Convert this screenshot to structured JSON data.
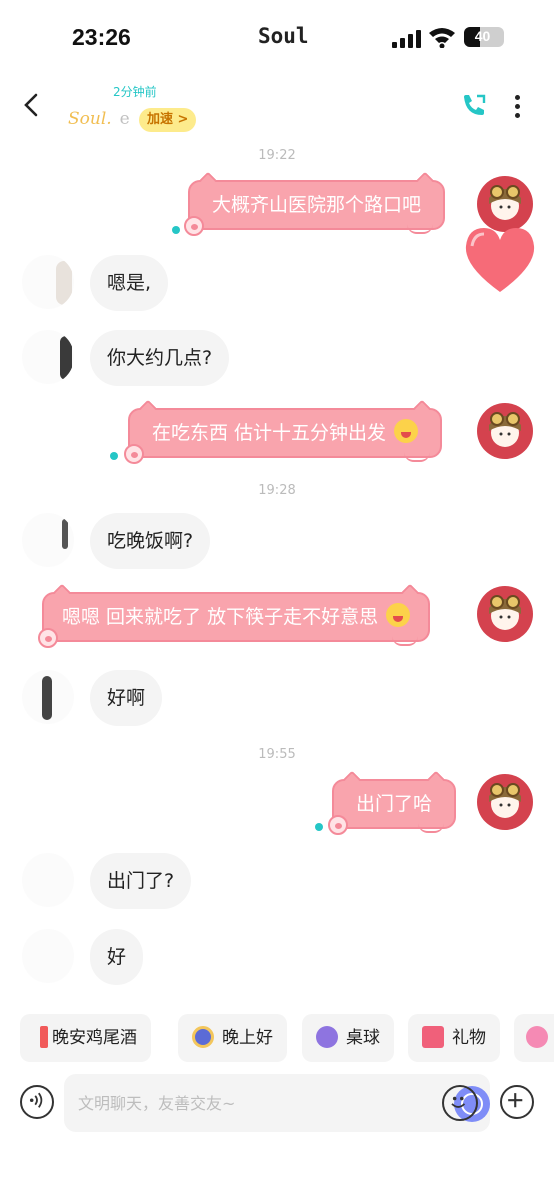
{
  "status": {
    "time": "23:26",
    "app": "Soul",
    "battery": "40",
    "battery_pct": 40
  },
  "header": {
    "last_seen": "2分钟前",
    "username": "Soul.",
    "username_suffix": "e",
    "boost_label": "加速 >"
  },
  "timestamps": [
    "19:22",
    "19:28",
    "19:55"
  ],
  "messages": [
    {
      "from": "me",
      "text": "大概齐山医院那个路口吧"
    },
    {
      "from": "other",
      "text": "嗯是,"
    },
    {
      "from": "other",
      "text": "你大约几点?"
    },
    {
      "from": "me",
      "text": "在吃东西 估计十五分钟出发",
      "emoji": "drooling-face"
    },
    {
      "from": "other",
      "text": "吃晚饭啊?"
    },
    {
      "from": "me",
      "text": "嗯嗯 回来就吃了 放下筷子走不好意思",
      "emoji": "rofl-face"
    },
    {
      "from": "other",
      "text": "好啊"
    },
    {
      "from": "me",
      "text": "出门了哈"
    },
    {
      "from": "other",
      "text": "出门了?"
    },
    {
      "from": "other",
      "text": "好"
    }
  ],
  "chips": [
    {
      "label": "晚安鸡尾酒",
      "icon": "cocktail-icon"
    },
    {
      "label": "晚上好",
      "icon": "moon-icon"
    },
    {
      "label": "桌球",
      "icon": "billiard-ball-icon"
    },
    {
      "label": "礼物",
      "icon": "gift-icon"
    }
  ],
  "input": {
    "placeholder": "文明聊天，友善交友~"
  },
  "colors": {
    "accent": "#25c6c6",
    "bubble_out": "#f9a4ad",
    "bubble_in": "#f4f4f4",
    "avatar_bg": "#d4424e"
  }
}
